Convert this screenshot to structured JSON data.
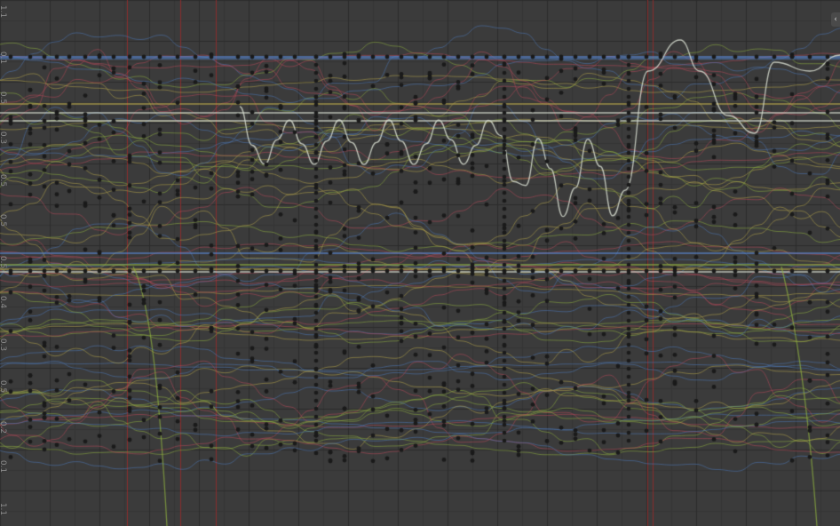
{
  "editor": {
    "ruler_labels": [
      "1.1",
      "0.1",
      "0.5",
      "0.3",
      "0.5",
      "0.5",
      "0.5",
      "0.4",
      "0.3",
      "0.5",
      "0.2",
      "0.1",
      "1.1"
    ],
    "collapse_glyph": "‹",
    "collapse_icon": "chevron-left-icon"
  },
  "colors": {
    "background": "#3b3b3b",
    "grid_major": "#2c2c2c",
    "grid_minor": "#353535",
    "frame_marker": "#8a2d2d",
    "key_fill": "#1a1a1a",
    "curve_blue": "#4d78b8",
    "curve_red": "#b8485a",
    "curve_green": "#8fb040",
    "curve_yellow": "#b6a64a",
    "curve_white": "#d6dccf",
    "active_blue": "#5a8ad8"
  }
}
